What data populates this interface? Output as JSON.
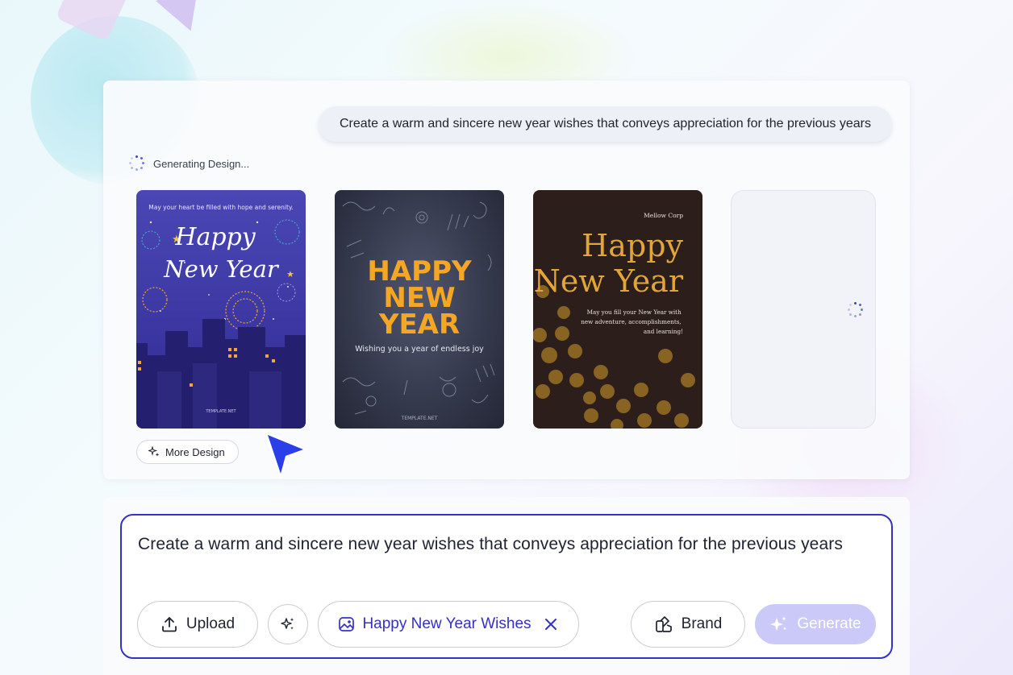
{
  "prompt_bubble": "Create a warm and sincere new year wishes that conveys appreciation for the previous years",
  "status": "Generating Design...",
  "cards": [
    {
      "top_text": "May your heart be filled with hope and serenity.",
      "title_line1": "Happy",
      "title_line2": "New Year",
      "footer": "TEMPLATE.NET"
    },
    {
      "title_line1": "HAPPY",
      "title_line2": "NEW",
      "title_line3": "YEAR",
      "subtitle": "Wishing you a year of endless joy",
      "footer": "TEMPLATE.NET"
    },
    {
      "company": "Mellow Corp",
      "title_line1": "Happy",
      "title_line2": "New Year",
      "message": "May you fill your New Year with new adventure, accomplishments, and learning!"
    }
  ],
  "more_design_label": "More Design",
  "input": {
    "text": "Create a warm and sincere new year wishes that conveys appreciation for the previous years"
  },
  "buttons": {
    "upload": "Upload",
    "tag": "Happy New Year Wishes",
    "brand": "Brand",
    "generate": "Generate"
  },
  "colors": {
    "accent": "#3431c4",
    "generate_bg": "#cbc9f7",
    "card1_bg": "#3b36a1",
    "card2_title": "#f5a623",
    "card3_title": "#e2a53a"
  },
  "icons": {
    "spinner": "loading-spinner-icon",
    "more": "sparkles-icon",
    "upload": "upload-icon",
    "magic": "magic-sparkles-icon",
    "tag": "image-icon",
    "remove": "close-icon",
    "brand": "brand-palette-icon",
    "generate": "sparkles-icon"
  }
}
